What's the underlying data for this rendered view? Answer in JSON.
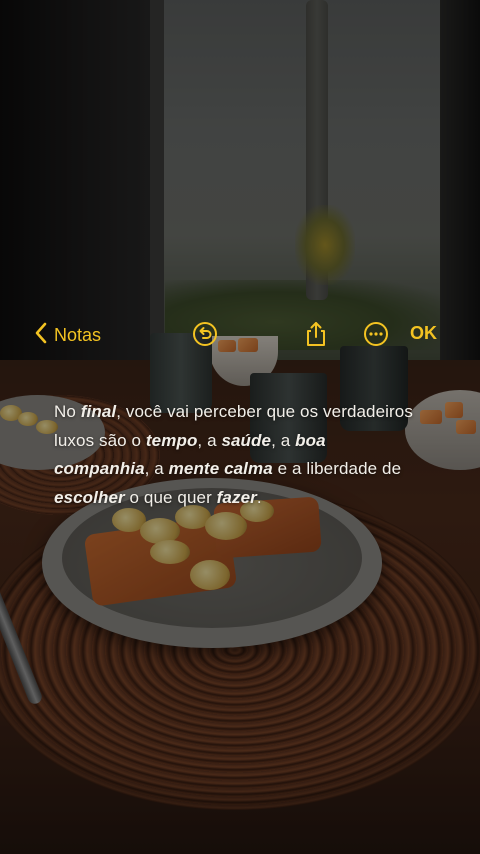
{
  "toolbar": {
    "back_label": "Notas",
    "done_label": "OK",
    "icons": [
      "chevron-left-icon",
      "undo-icon",
      "share-icon",
      "more-icon"
    ],
    "accent_color": "#f3c322"
  },
  "note": {
    "segments": [
      {
        "text": "No ",
        "emphasis": false
      },
      {
        "text": "final",
        "emphasis": true
      },
      {
        "text": ", você vai perceber que os verdadeiros luxos são o ",
        "emphasis": false
      },
      {
        "text": "tempo",
        "emphasis": true
      },
      {
        "text": ", a ",
        "emphasis": false
      },
      {
        "text": "saúde",
        "emphasis": true
      },
      {
        "text": ", a ",
        "emphasis": false
      },
      {
        "text": "boa companhia",
        "emphasis": true
      },
      {
        "text": ", a ",
        "emphasis": false
      },
      {
        "text": "mente calma",
        "emphasis": true
      },
      {
        "text": " e a liberdade de ",
        "emphasis": false
      },
      {
        "text": "escolher",
        "emphasis": true
      },
      {
        "text": " o que quer ",
        "emphasis": false
      },
      {
        "text": "fazer",
        "emphasis": true
      },
      {
        "text": ".",
        "emphasis": false
      }
    ]
  }
}
